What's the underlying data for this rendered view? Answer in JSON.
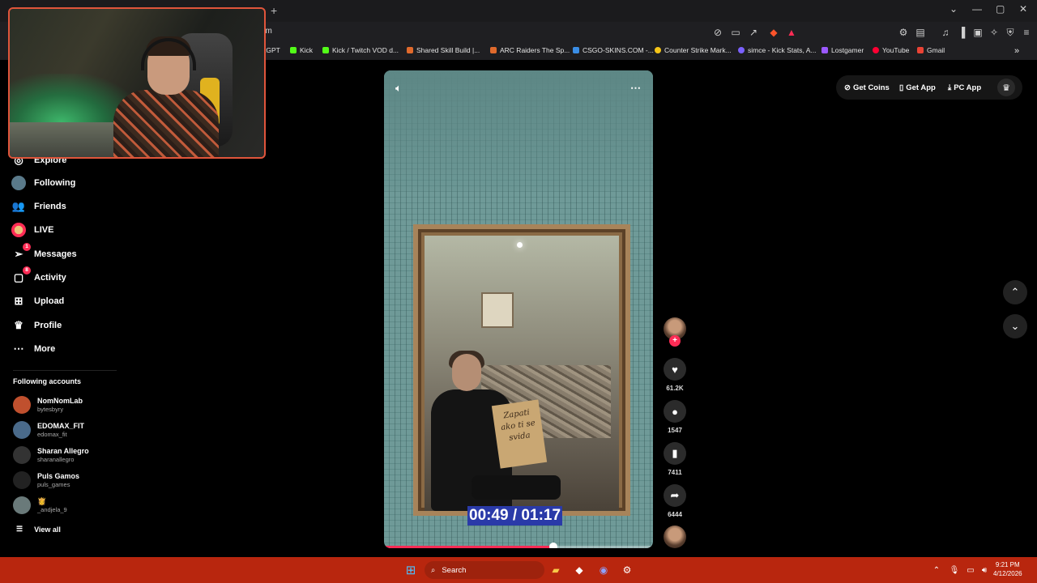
{
  "browser": {
    "url_fragment": "om",
    "newtab_icon": "+",
    "bookmarks": [
      {
        "label": "tGPT",
        "color": "#10a37f"
      },
      {
        "label": "Kick",
        "color": "#53fc18"
      },
      {
        "label": "Kick / Twitch VOD d...",
        "color": "#53fc18"
      },
      {
        "label": "Shared Skill Build |...",
        "color": "#e06a2c"
      },
      {
        "label": "ARC Raiders The Sp...",
        "color": "#e06a2c"
      },
      {
        "label": "CSGO-SKINS.COM -...",
        "color": "#3a8ee6"
      },
      {
        "label": "Counter Strike Mark...",
        "color": "#f5c518"
      },
      {
        "label": "simce - Kick Stats, A...",
        "color": "#7b61ff"
      },
      {
        "label": "Lostgamer",
        "color": "#9b59ff"
      },
      {
        "label": "YouTube",
        "color": "#ff0033"
      },
      {
        "label": "Gmail",
        "color": "#ea4335"
      }
    ]
  },
  "sidebar": {
    "items": [
      {
        "label": "Explore",
        "icon": "compass-icon"
      },
      {
        "label": "Following",
        "icon": "avatar"
      },
      {
        "label": "Friends",
        "icon": "friends-icon"
      },
      {
        "label": "LIVE",
        "icon": "avatar"
      },
      {
        "label": "Messages",
        "icon": "send-icon",
        "badge": "1"
      },
      {
        "label": "Activity",
        "icon": "bell-icon",
        "badge": "8"
      },
      {
        "label": "Upload",
        "icon": "plus-square-icon"
      },
      {
        "label": "Profile",
        "icon": "profile-icon"
      },
      {
        "label": "More",
        "icon": "more-icon"
      }
    ],
    "following_title": "Following accounts",
    "accounts": [
      {
        "name": "NomNomLab",
        "handle": "bytesbyry",
        "color": "#c0502e"
      },
      {
        "name": "EDOMAX_FIT",
        "handle": "edomax_fit",
        "color": "#4a6a8a"
      },
      {
        "name": "Sharan Allegro",
        "handle": "sharanallegro",
        "color": "#333"
      },
      {
        "name": "Puls Gamos",
        "handle": "puls_games",
        "color": "#222"
      },
      {
        "name": "👸",
        "handle": "_andjela_9",
        "color": "#6a7a7a"
      }
    ],
    "view_all": "View all"
  },
  "video": {
    "timecode": "00:49 / 01:17",
    "progress": 0.63,
    "sign_text": "Zapati ako ti se svida"
  },
  "actions": {
    "likes": "61.2K",
    "comments": "1547",
    "saves": "7411",
    "shares": "6444"
  },
  "top_actions": {
    "get_coins": "Get Coins",
    "get_app": "Get App",
    "pc_app": "PC App"
  },
  "taskbar": {
    "search_label": "Search",
    "time": "9:21 PM",
    "date": "4/12/2026"
  }
}
